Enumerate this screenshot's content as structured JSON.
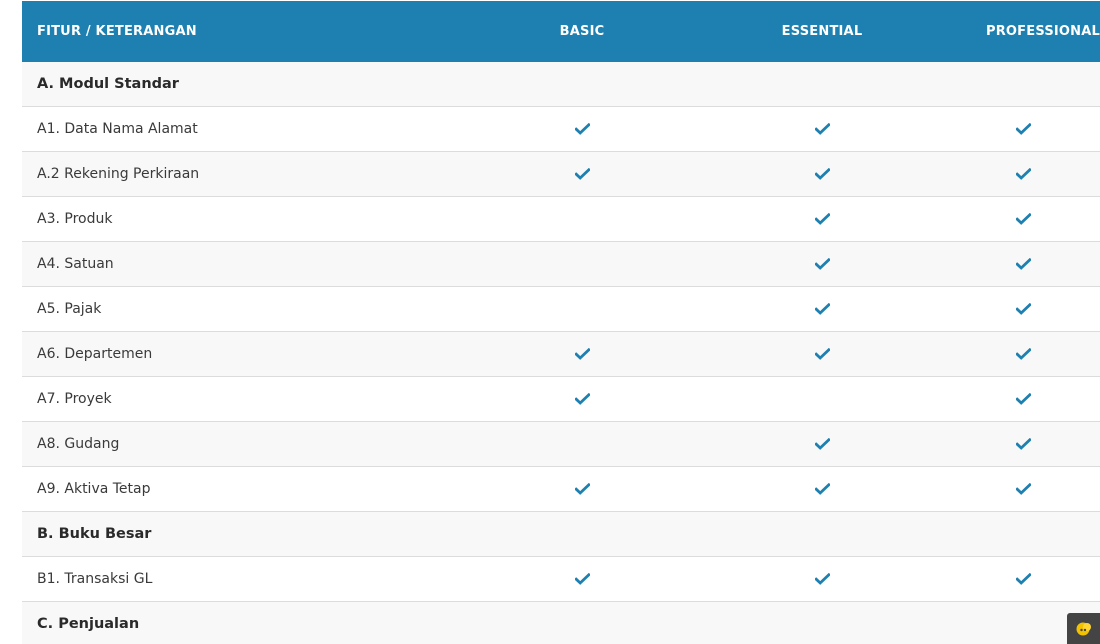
{
  "header": {
    "feature": "FITUR / KETERANGAN",
    "plans": [
      "BASIC",
      "ESSENTIAL",
      "PROFESSIONAL"
    ]
  },
  "rows": [
    {
      "label": "A. Modul Standar",
      "section": true,
      "checks": [
        false,
        false,
        false
      ]
    },
    {
      "label": "A1. Data Nama Alamat",
      "section": false,
      "checks": [
        true,
        true,
        true
      ]
    },
    {
      "label": "A.2 Rekening Perkiraan",
      "section": false,
      "checks": [
        true,
        true,
        true
      ]
    },
    {
      "label": "A3. Produk",
      "section": false,
      "checks": [
        false,
        true,
        true
      ]
    },
    {
      "label": "A4. Satuan",
      "section": false,
      "checks": [
        false,
        true,
        true
      ]
    },
    {
      "label": "A5. Pajak",
      "section": false,
      "checks": [
        false,
        true,
        true
      ]
    },
    {
      "label": "A6. Departemen",
      "section": false,
      "checks": [
        true,
        true,
        true
      ]
    },
    {
      "label": "A7. Proyek",
      "section": false,
      "checks": [
        true,
        false,
        true
      ]
    },
    {
      "label": "A8. Gudang",
      "section": false,
      "checks": [
        false,
        true,
        true
      ]
    },
    {
      "label": "A9. Aktiva Tetap",
      "section": false,
      "checks": [
        true,
        true,
        true
      ]
    },
    {
      "label": "B. Buku Besar",
      "section": true,
      "checks": [
        false,
        false,
        false
      ]
    },
    {
      "label": "B1. Transaksi GL",
      "section": false,
      "checks": [
        true,
        true,
        true
      ]
    },
    {
      "label": "C. Penjualan",
      "section": true,
      "checks": [
        false,
        false,
        false
      ]
    }
  ],
  "colors": {
    "header_bg": "#1e80b0",
    "check": "#1e80b0",
    "odd_row_bg": "#f8f8f8"
  },
  "icons": {
    "check": "check-icon",
    "widget": "chat-widget-icon"
  }
}
